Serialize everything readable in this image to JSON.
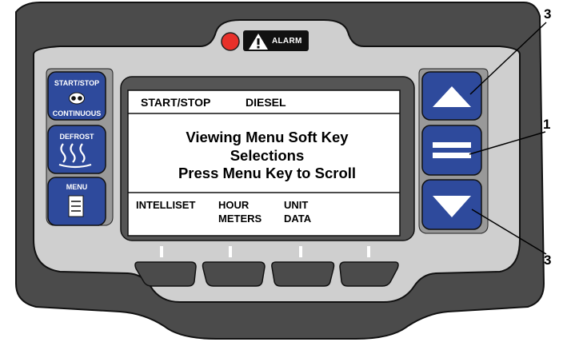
{
  "indicator": {
    "alarm_label": "ALARM"
  },
  "keys": {
    "start_stop_label": "START/STOP",
    "continuous_label": "CONTINUOUS",
    "defrost_label": "DEFROST",
    "menu_label": "MENU"
  },
  "screen": {
    "status_left": "START/STOP",
    "status_right": "DIESEL",
    "message": [
      "Viewing Menu Soft Key",
      "Selections",
      "Press Menu Key to Scroll"
    ],
    "soft_keys": [
      {
        "line1": "INTELLISET",
        "line2": ""
      },
      {
        "line1": "HOUR",
        "line2": "METERS"
      },
      {
        "line1": "UNIT",
        "line2": "DATA"
      },
      {
        "line1": "",
        "line2": ""
      }
    ]
  },
  "callouts": {
    "up_key": "3",
    "enter_key": "1",
    "down_key": "3"
  },
  "colors": {
    "housing": "#4d4d4d",
    "bezel": "#cfcfcf",
    "key_blue": "#2e4a9c",
    "alarm_red": "#e8302a"
  }
}
